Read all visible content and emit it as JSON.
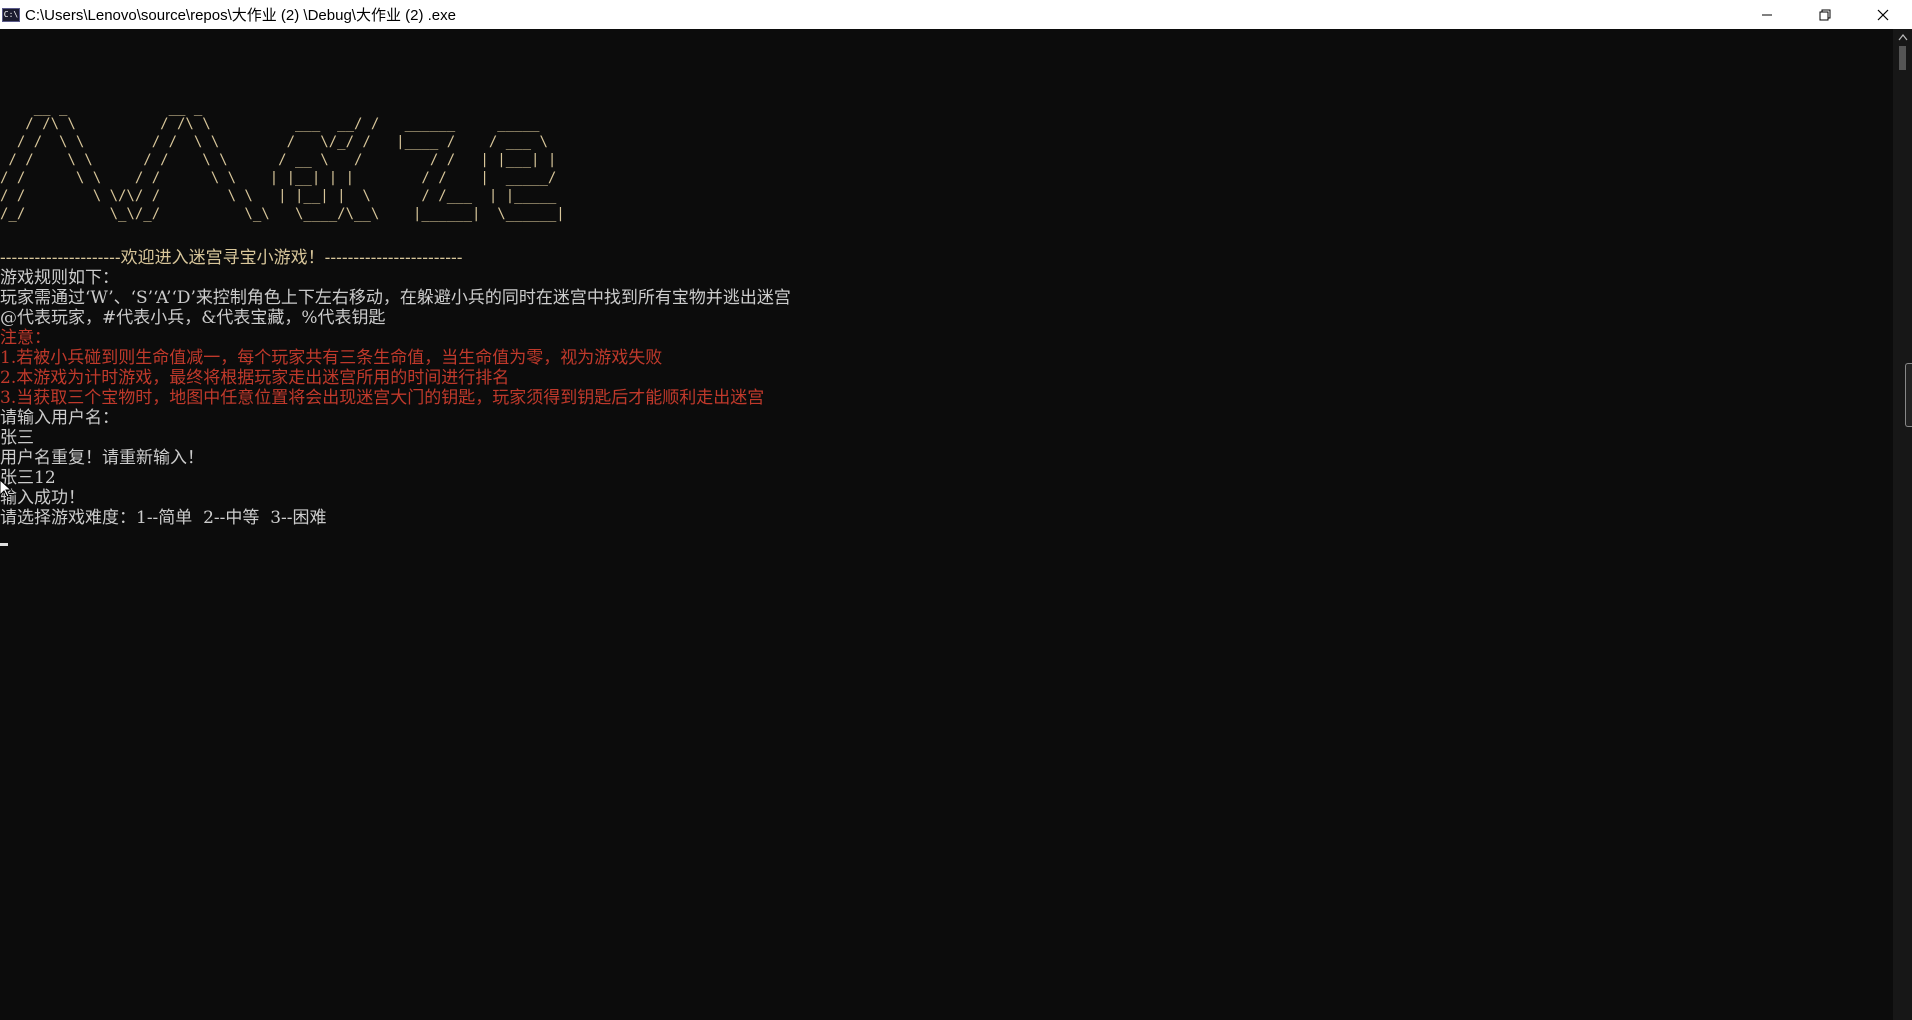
{
  "window": {
    "title": "C:\\Users\\Lenovo\\source\\repos\\大作业 (2) \\Debug\\大作业 (2) .exe",
    "icon": "console-app-icon",
    "controls": [
      "minimize-icon",
      "restore-icon",
      "close-icon"
    ]
  },
  "logo": {
    "lines": [
      "    __ _            __ _",
      "   / /\\ \\          / /\\ \\          ___  __/ /   ______     _____",
      "  / /  \\ \\        / /  \\ \\        /   \\/_/ /   |____ /    / ___ \\",
      " / /    \\ \\      / /    \\ \\      / __ \\   /        / /   | |___| |",
      "/ /      \\ \\    / /      \\ \\    | |__| | |        / /    |  _____/",
      "/ /        \\ \\/\\/ /        \\ \\   | |__| |  \\      / /___  | |_____",
      "/_/          \\_\\/_/          \\_\\   \\____/\\__\\    |______|  \\______|"
    ]
  },
  "console": {
    "welcome": "---------------------欢迎进入迷宫寻宝小游戏！------------------------",
    "rules_heading": "游戏规则如下：",
    "rule_controls": "玩家需通过‘W’、‘S’‘A’‘D’来控制角色上下左右移动，在躲避小兵的同时在迷宫中找到所有宝物并逃出迷宫",
    "rule_symbols": "@代表玩家，#代表小兵，&代表宝藏，%代表钥匙",
    "note_heading": "注意：",
    "note_1": "1.若被小兵碰到则生命值减一，每个玩家共有三条生命值，当生命值为零，视为游戏失败",
    "note_2": "2.本游戏为计时游戏，最终将根据玩家走出迷宫所用的时间进行排名",
    "note_3": "3.当获取三个宝物时，地图中任意位置将会出现迷宫大门的钥匙，玩家须得到钥匙后才能顺利走出迷宫",
    "prompt_username": "请输入用户名：",
    "input_1": "张三",
    "error_duplicate": "用户名重复！请重新输入！",
    "input_2": "张三12",
    "success": "输入成功！",
    "prompt_difficulty": "请选择游戏难度：1--简单  2--中等  3--困难"
  },
  "colors": {
    "background": "#0c0c0c",
    "text": "#cccccc",
    "warning": "#c0392b",
    "logo": "#d8c69a"
  }
}
